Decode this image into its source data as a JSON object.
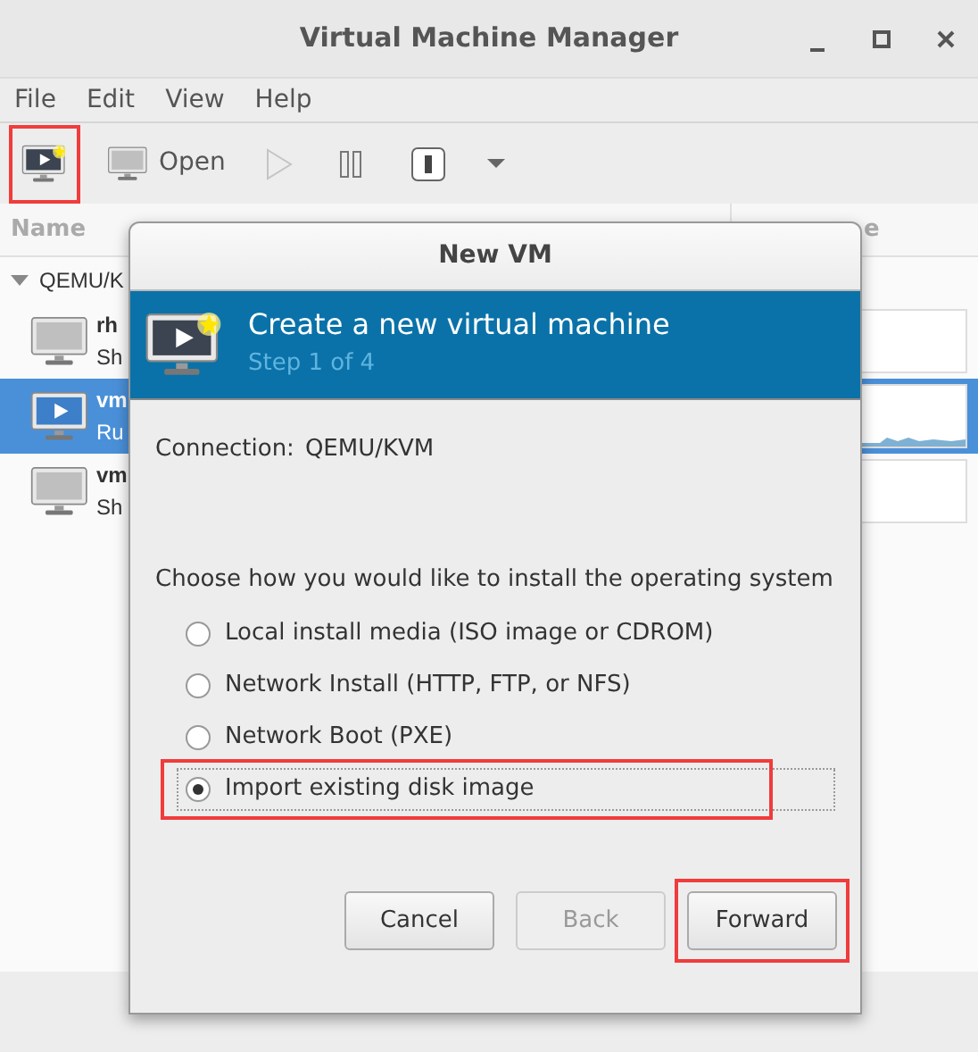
{
  "window": {
    "title": "Virtual Machine Manager"
  },
  "menu": [
    "File",
    "Edit",
    "View",
    "Help"
  ],
  "toolbar": [
    {
      "kind": "new",
      "disabled": false,
      "highlighted": true
    },
    {
      "kind": "open",
      "label": "Open",
      "disabled": false,
      "highlighted": false
    },
    {
      "kind": "run",
      "disabled": true,
      "highlighted": false
    },
    {
      "kind": "pause",
      "disabled": false,
      "highlighted": false
    },
    {
      "kind": "shutdown",
      "disabled": false,
      "highlighted": false
    },
    {
      "kind": "menu",
      "disabled": false,
      "highlighted": false
    }
  ],
  "vm_list": {
    "columns": [
      "Name",
      "e"
    ],
    "groups": [
      {
        "name": "QEMU/K",
        "expanded": true,
        "children": [
          {
            "name": "rh",
            "status": "Sh",
            "running": false,
            "selected": false
          },
          {
            "name": "vm",
            "status": "Ru",
            "running": true,
            "selected": true
          },
          {
            "name": "vm",
            "status": "Sh",
            "running": false,
            "selected": false
          }
        ]
      }
    ]
  },
  "dialog": {
    "title": "New VM",
    "banner": {
      "title": "Create a new virtual machine",
      "subtitle": "Step 1 of 4"
    },
    "connection": {
      "label": "Connection:",
      "value": "QEMU/KVM"
    },
    "prompt": "Choose how you would like to install the operating system",
    "options": [
      {
        "label": "Local install media (ISO image or CDROM)",
        "selected": false,
        "focused": false,
        "highlighted": false
      },
      {
        "label": "Network Install (HTTP, FTP, or NFS)",
        "selected": false,
        "focused": false,
        "highlighted": false
      },
      {
        "label": "Network Boot (PXE)",
        "selected": false,
        "focused": false,
        "highlighted": false
      },
      {
        "label": "Import existing disk image",
        "selected": true,
        "focused": true,
        "highlighted": true
      }
    ],
    "buttons": [
      {
        "label": "Cancel",
        "disabled": false,
        "highlighted": false
      },
      {
        "label": "Back",
        "disabled": true,
        "highlighted": false
      },
      {
        "label": "Forward",
        "disabled": false,
        "highlighted": true
      }
    ]
  }
}
